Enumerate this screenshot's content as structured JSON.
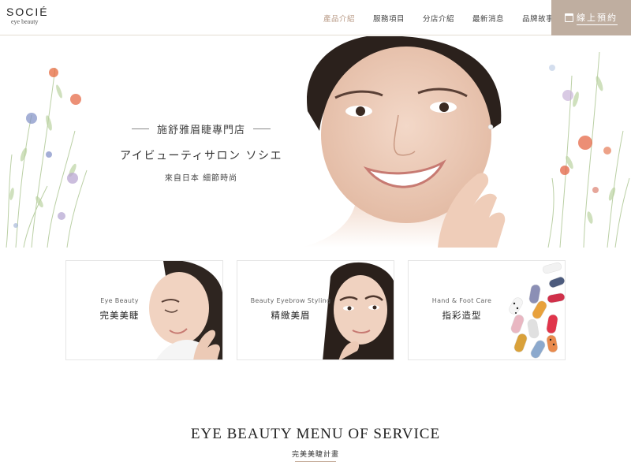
{
  "brand": {
    "name": "SOCIÉ",
    "sub": "eye beauty"
  },
  "nav": {
    "items": [
      {
        "label": "產品介紹",
        "active": true
      },
      {
        "label": "服務項目",
        "active": false
      },
      {
        "label": "分店介紹",
        "active": false
      },
      {
        "label": "最新消息",
        "active": false
      },
      {
        "label": "品牌故事",
        "active": false
      }
    ],
    "booking_label": "線上預約"
  },
  "hero": {
    "title": "施舒雅眉睫專門店",
    "japanese": "アイビューティサロン ソシエ",
    "tagline": "來自日本 細節時尚"
  },
  "cards": [
    {
      "en": "Eye Beauty",
      "zh": "完美美睫"
    },
    {
      "en": "Beauty Eyebrow Styling",
      "zh": "精緻美眉"
    },
    {
      "en": "Hand & Foot Care",
      "zh": "指彩造型"
    }
  ],
  "section": {
    "title": "EYE BEAUTY MENU OF SERVICE",
    "subtitle": "完美美睫計畫"
  },
  "colors": {
    "accent": "#bfaea0",
    "active_nav": "#b89a86",
    "underline": "#c4ab98"
  }
}
